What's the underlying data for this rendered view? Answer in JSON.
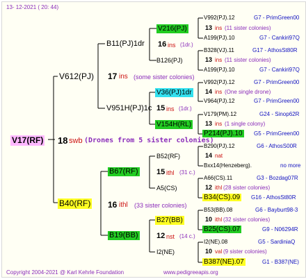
{
  "header": {
    "date": "13- 12-2021 ( 20: 44)"
  },
  "footer": {
    "copyright": "Copyright 2004-2021 @ Karl Kehrle Foundation",
    "url": "www.pedigreeapis.org"
  },
  "colors": {
    "green": "#22cc22",
    "yellow": "#ffff22",
    "cyan": "#33e0ee",
    "pink": "#ffb8ff",
    "red": "#cc1010",
    "blue": "#1010c0",
    "purple": "#8a2cba"
  },
  "queen": {
    "name": "V17(RF)"
  },
  "gen1": {
    "num": "18",
    "ins": "swb",
    "note": "(Drones from 5 sister colonies)"
  },
  "sire": {
    "name": "V612(PJ)",
    "num": "17",
    "ins": "ins",
    "note": "(some sister colonies)"
  },
  "dam": {
    "name": "B40(RF)",
    "num": "16",
    "ins": "ithl",
    "note": "(33 sister colonies)"
  },
  "ss": {
    "name": "B11(PJ)1dr",
    "num": "16",
    "ins": "ins",
    "note": "(1dr.)"
  },
  "sd": {
    "name": "V951H(PJ)1c",
    "num": "15",
    "ins": "ins",
    "note": "(1dr.)"
  },
  "ds": {
    "name": "B67(RF)",
    "num": "15",
    "ins": "ithl",
    "note": "(31 c.)"
  },
  "dd": {
    "name": "B19(BB)",
    "num": "12",
    "ins": "nst",
    "note": "(14 c.)"
  },
  "g3": [
    {
      "name": "V216(PJ)",
      "sire": "V992(PJ).12",
      "sire_info": "G7 - PrimGreen00",
      "num": "13",
      "ins": "ins",
      "note": "(11 sister colonies)",
      "dam": "A199(PJ).10",
      "dam_info": "G7 - Cankiri97Q"
    },
    {
      "name": "B126(PJ)",
      "sire": "B328(VJ).11",
      "sire_info": "G17 - AthosSt80R",
      "num": "13",
      "ins": "ins",
      "note": "(11 sister colonies)",
      "dam": "A199(PJ).10",
      "dam_info": "G7 - Cankiri97Q"
    },
    {
      "name": "V36(PJ)1dr",
      "sire": "V992(PJ).12",
      "sire_info": "G7 - PrimGreen00",
      "num": "14",
      "ins": "ins",
      "note": "(One single drone)",
      "dam": "V964(PJ).12",
      "dam_info": "G7 - PrimGreen00"
    },
    {
      "name": "V154H(RL)",
      "sire": "V179(PM).12",
      "sire_info": "G24 - Sinop62R",
      "num": "13",
      "ins": "ins",
      "note": "(1 single colony)",
      "dam": "P214(PJ).10",
      "dam_info": "G5 - PrimGreen00"
    },
    {
      "name": "B52(RF)",
      "sire": "B290(PJ).12",
      "sire_info": "G6 - AthosS00R",
      "num": "14",
      "ins": "nat",
      "note": "",
      "dam": "Bxx14(Henzeberg).",
      "dam_info": "no more"
    },
    {
      "name": "A5(CS)",
      "sire": "A66(CS).11",
      "sire_info": "G3 - Bozdag07R",
      "num": "12",
      "ins": "ithl",
      "note": "(28 sister colonies)",
      "dam": "B34(CS).09",
      "dam_info": "G16 - AthosSt80R"
    },
    {
      "name": "B27(BB)",
      "sire": "B53(BB).08",
      "sire_info": "G6 - Bayburt98-3",
      "num": "10",
      "ins": "ithl",
      "note": "(32 sister colonies)",
      "dam": "B25(CS).07",
      "dam_info": "G9 - N06294R"
    },
    {
      "name": "I2(NE)",
      "sire": "I2(NE).08",
      "sire_info": "G5 - SardiniaQ",
      "num": "10",
      "ins": "val",
      "note": "(9 sister colonies)",
      "dam": "B387(NE).07",
      "dam_info": "G1 - B387(NE)"
    }
  ]
}
